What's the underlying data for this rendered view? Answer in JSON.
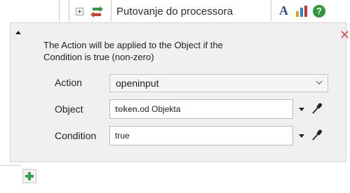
{
  "toolbar": {
    "node_title": "Putovanje do processora",
    "font_icon_glyph": "A",
    "help_icon_glyph": "?",
    "icons": [
      "expand-icon",
      "arrows-icon",
      "font-icon",
      "chart-icon",
      "help-icon"
    ]
  },
  "panel": {
    "description": "The Action will be applied to the Object if the Condition is true (non-zero)",
    "close_glyph": "✕",
    "action": {
      "label": "Action",
      "value": "openinput"
    },
    "object": {
      "label": "Object",
      "keyword": "token.",
      "value": "od Objekta"
    },
    "condition": {
      "label": "Condition",
      "value": "true"
    }
  },
  "colors": {
    "panel_bg": "#f0f0f0",
    "close": "#d9534f",
    "add": "#3aa34a",
    "help": "#2f9a3a"
  }
}
